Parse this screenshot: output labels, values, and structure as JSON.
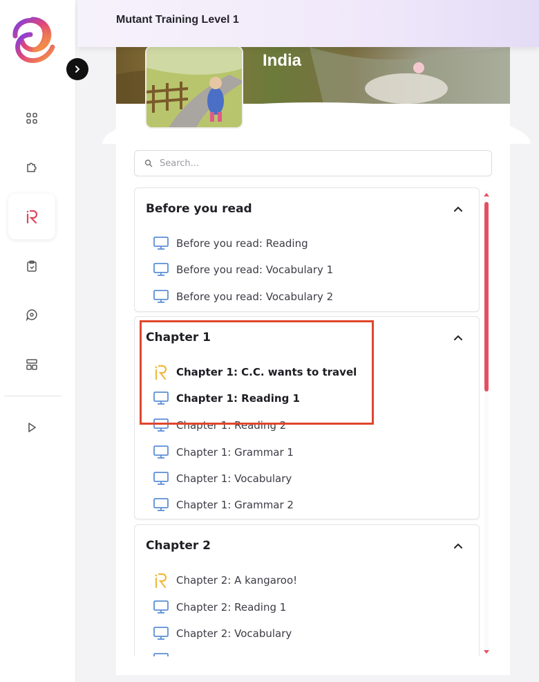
{
  "header": {
    "title": "Mutant Training Level 1"
  },
  "banner": {
    "title": "India"
  },
  "search": {
    "placeholder": "Search..."
  },
  "sidebar": {
    "items": [
      {
        "icon": "apps-icon"
      },
      {
        "icon": "puzzle-icon"
      },
      {
        "icon": "reading-r-icon",
        "active": true
      },
      {
        "icon": "clipboard-icon"
      },
      {
        "icon": "chat-icon"
      },
      {
        "icon": "layout-icon"
      },
      {
        "icon": "play-icon"
      }
    ]
  },
  "sections": [
    {
      "title": "Before you read",
      "items": [
        {
          "label": "Before you read: Reading",
          "icon": "monitor-icon"
        },
        {
          "label": "Before you read: Vocabulary 1",
          "icon": "monitor-icon"
        },
        {
          "label": "Before you read: Vocabulary 2",
          "icon": "monitor-icon"
        }
      ]
    },
    {
      "title": "Chapter 1",
      "items": [
        {
          "label": "Chapter 1: C.C. wants to travel",
          "icon": "reading-r-icon",
          "bold": true
        },
        {
          "label": "Chapter 1: Reading 1",
          "icon": "monitor-icon",
          "bold": true
        },
        {
          "label": "Chapter 1: Reading 2",
          "icon": "monitor-icon"
        },
        {
          "label": "Chapter 1: Grammar 1",
          "icon": "monitor-icon"
        },
        {
          "label": "Chapter 1: Vocabulary",
          "icon": "monitor-icon"
        },
        {
          "label": "Chapter 1: Grammar 2",
          "icon": "monitor-icon"
        }
      ]
    },
    {
      "title": "Chapter 2",
      "items": [
        {
          "label": "Chapter 2: A kangaroo!",
          "icon": "reading-r-icon"
        },
        {
          "label": "Chapter 2: Reading 1",
          "icon": "monitor-icon"
        },
        {
          "label": "Chapter 2: Vocabulary",
          "icon": "monitor-icon"
        }
      ]
    }
  ],
  "colors": {
    "accent": "#e45060",
    "highlight": "#e0452c",
    "monitor_icon": "#5b8fd6",
    "r_icon": "#f0b73a"
  }
}
